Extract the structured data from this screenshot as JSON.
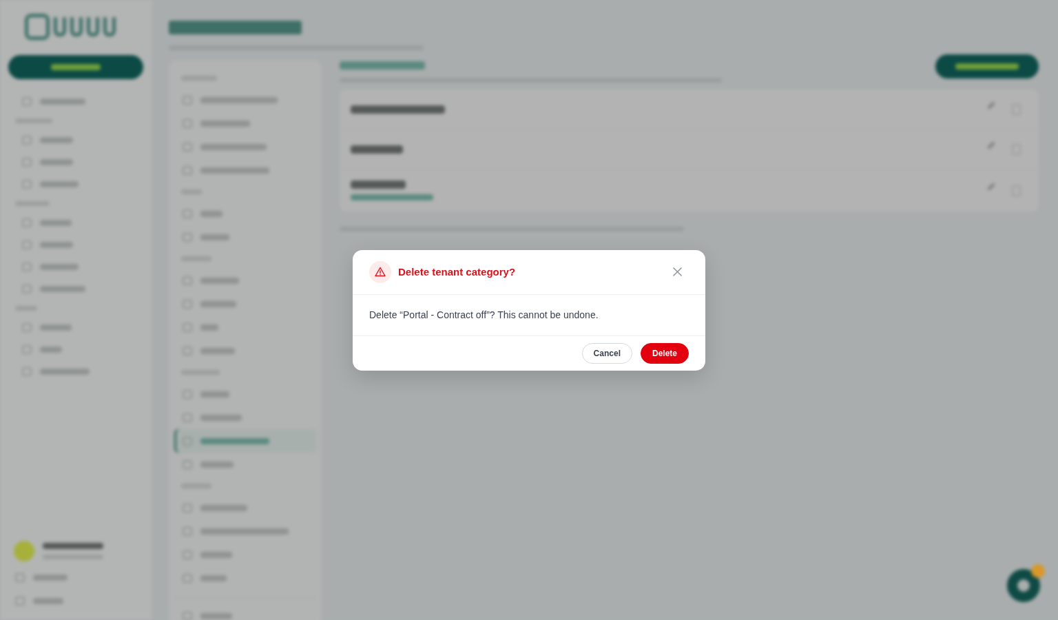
{
  "dialog": {
    "title": "Delete tenant category?",
    "message": "Delete “Portal - Contract off”? This cannot be undone.",
    "buttons": [
      {
        "label": "Cancel",
        "kind": "secondary"
      },
      {
        "label": "Delete",
        "kind": "danger"
      }
    ]
  }
}
